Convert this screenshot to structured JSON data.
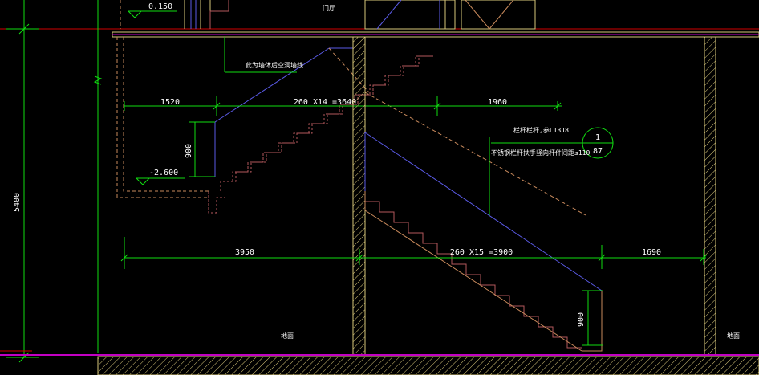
{
  "drawing": {
    "dimensions": {
      "overall_height": "5400",
      "upper_left": "1520",
      "upper_middle": "260 X14 =3640",
      "upper_right": "1960",
      "upper_height": "900",
      "lower_left": "3950",
      "lower_middle": "260 X15 =3900",
      "lower_right": "1690",
      "lower_height": "900"
    },
    "levels": {
      "top": "0.150",
      "middle": "-2.600"
    },
    "notes": {
      "upper_note": "此为墙体后空洞墙线",
      "railing_note": "栏杆栏杆,参L13J8",
      "railing_spec": "不锈钢栏杆扶手竖向杆件间距≤110",
      "door_label": "门厅"
    },
    "detail_callout": {
      "number": "1",
      "sheet": "87"
    },
    "small_labels": {
      "left": "地面",
      "right": "地面"
    },
    "colors": {
      "background": "#000000",
      "wall": "#d8c77a",
      "stair_section": "#b3585d",
      "stair_outline": "#c98a5c",
      "dimension": "#11dd11",
      "handrail": "#5a5ae6",
      "ground": "#c300c3",
      "red_line": "#d20000",
      "text": "#ffffff"
    }
  }
}
